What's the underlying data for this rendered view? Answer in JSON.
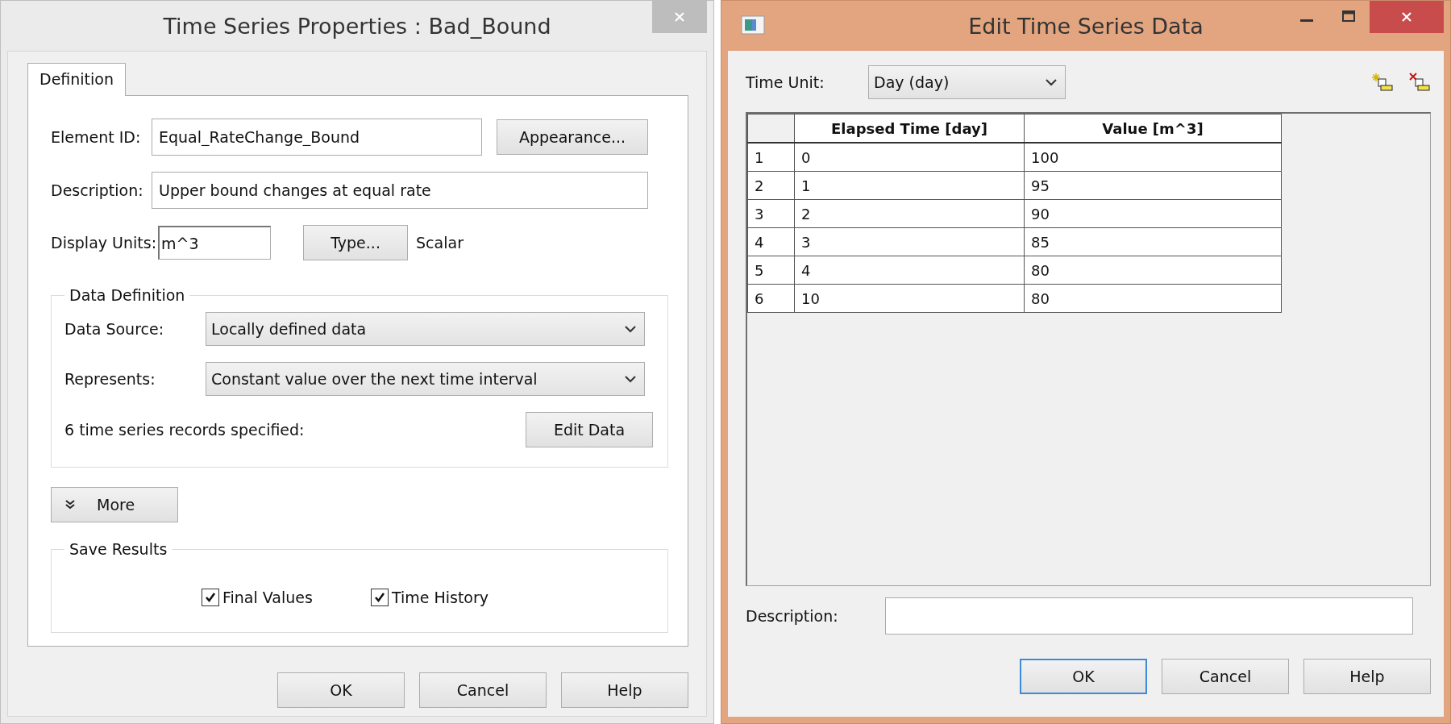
{
  "properties_dialog": {
    "title": "Time Series Properties : Bad_Bound",
    "tabs": [
      {
        "label": "Definition",
        "selected": true
      }
    ],
    "element_id": {
      "label": "Element ID:",
      "value": "Equal_RateChange_Bound"
    },
    "appearance_button": "Appearance...",
    "description": {
      "label": "Description:",
      "value": "Upper bound changes at equal rate"
    },
    "display_units": {
      "label": "Display Units:",
      "value": "m^3"
    },
    "type_button": "Type...",
    "type_value": "Scalar",
    "data_definition": {
      "title": "Data Definition",
      "data_source": {
        "label": "Data Source:",
        "value": "Locally defined data"
      },
      "represents": {
        "label": "Represents:",
        "value": "Constant value over the next time interval"
      },
      "records_text": "6 time series records specified:",
      "edit_button": "Edit Data"
    },
    "more_button": "More",
    "save_results": {
      "title": "Save Results",
      "options": [
        {
          "label": "Final Values",
          "checked": true
        },
        {
          "label": "Time History",
          "checked": true
        }
      ]
    },
    "buttons": [
      "OK",
      "Cancel",
      "Help"
    ]
  },
  "edit_dialog": {
    "title": "Edit Time Series Data",
    "time_unit": {
      "label": "Time Unit:",
      "value": "Day (day)"
    },
    "table": {
      "columns": [
        "Elapsed Time [day]",
        "Value [m^3]"
      ],
      "rows": [
        {
          "index": "1",
          "time": "0",
          "value": "100"
        },
        {
          "index": "2",
          "time": "1",
          "value": "95"
        },
        {
          "index": "3",
          "time": "2",
          "value": "90"
        },
        {
          "index": "4",
          "time": "3",
          "value": "85"
        },
        {
          "index": "5",
          "time": "4",
          "value": "80"
        },
        {
          "index": "6",
          "time": "10",
          "value": "80"
        }
      ]
    },
    "description": {
      "label": "Description:"
    },
    "buttons": [
      {
        "label": "OK",
        "selected": true
      },
      {
        "label": "Cancel",
        "selected": false
      },
      {
        "label": "Help",
        "selected": false
      }
    ]
  }
}
